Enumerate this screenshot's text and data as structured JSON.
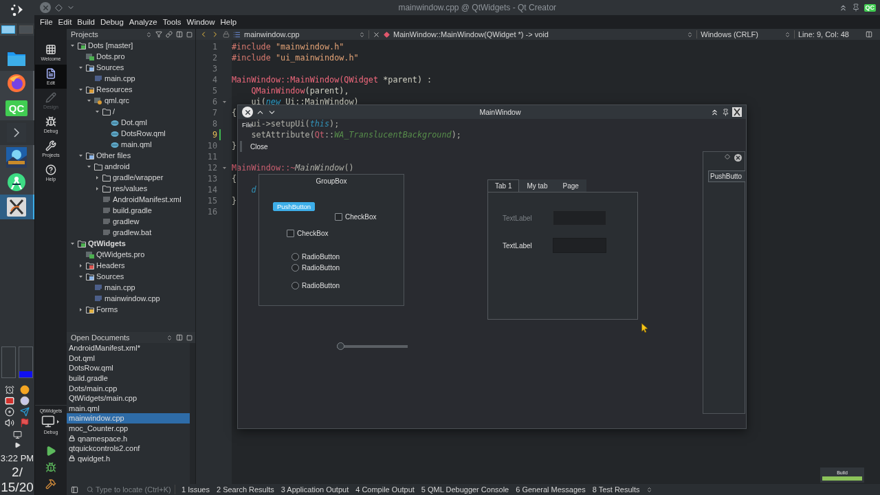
{
  "window": {
    "title": "mainwindow.cpp @ QtWidgets - Qt Creator",
    "badge": "QC"
  },
  "taskbar": {
    "desktops": [
      {
        "selected": true
      },
      {
        "selected": false
      }
    ],
    "apps": [
      {
        "kind": "folder",
        "running": false,
        "selected": false
      },
      {
        "kind": "browser",
        "running": true,
        "selected": false
      },
      {
        "kind": "ide",
        "text": "QC",
        "running": true,
        "selected": false
      },
      {
        "kind": "terminal",
        "running": false,
        "selected": false
      },
      {
        "kind": "game",
        "running": true,
        "selected": false
      },
      {
        "kind": "android",
        "running": true,
        "selected": false
      },
      {
        "kind": "xapp",
        "running": true,
        "selected": true
      }
    ],
    "meters": [
      {
        "level": 0
      },
      {
        "level": 0.2
      }
    ],
    "clock": [
      "3:22 PM",
      "2/",
      "15/20"
    ]
  },
  "menu": [
    "File",
    "Edit",
    "Build",
    "Debug",
    "Analyze",
    "Tools",
    "Window",
    "Help"
  ],
  "modes": [
    {
      "label": "Welcome",
      "kind": "welcome",
      "selected": false,
      "disabled": false
    },
    {
      "label": "Edit",
      "kind": "edit",
      "selected": true,
      "disabled": false
    },
    {
      "label": "Design",
      "kind": "design",
      "selected": false,
      "disabled": true
    },
    {
      "label": "Debug",
      "kind": "debug",
      "selected": false,
      "disabled": false
    },
    {
      "label": "Projects",
      "kind": "projects",
      "selected": false,
      "disabled": false
    },
    {
      "label": "Help",
      "kind": "help",
      "selected": false,
      "disabled": false
    }
  ],
  "kit": {
    "project": "QtWidgets",
    "config": "Debug"
  },
  "projects": {
    "title": "Projects",
    "tree": [
      {
        "label": "Dots [master]",
        "kind": "project",
        "expanded": true,
        "active": false,
        "children": [
          {
            "label": "Dots.pro",
            "kind": "pro"
          },
          {
            "label": "Sources",
            "kind": "sources",
            "expanded": true,
            "children": [
              {
                "label": "main.cpp",
                "kind": "cpp"
              }
            ]
          },
          {
            "label": "Resources",
            "kind": "resources",
            "expanded": true,
            "children": [
              {
                "label": "qml.qrc",
                "kind": "qrc",
                "expanded": true,
                "children": [
                  {
                    "label": "/",
                    "kind": "folder",
                    "expanded": true,
                    "children": [
                      {
                        "label": "Dot.qml",
                        "kind": "qml"
                      },
                      {
                        "label": "DotsRow.qml",
                        "kind": "qml"
                      },
                      {
                        "label": "main.qml",
                        "kind": "qml"
                      }
                    ]
                  }
                ]
              }
            ]
          },
          {
            "label": "Other files",
            "kind": "sources",
            "expanded": true,
            "children": [
              {
                "label": "android",
                "kind": "folder",
                "expanded": true,
                "children": [
                  {
                    "label": "gradle/wrapper",
                    "kind": "folder",
                    "expanded": false
                  },
                  {
                    "label": "res/values",
                    "kind": "folder",
                    "expanded": false
                  },
                  {
                    "label": "AndroidManifest.xml",
                    "kind": "file"
                  },
                  {
                    "label": "build.gradle",
                    "kind": "file"
                  },
                  {
                    "label": "gradlew",
                    "kind": "file"
                  },
                  {
                    "label": "gradlew.bat",
                    "kind": "file"
                  }
                ]
              }
            ]
          }
        ]
      },
      {
        "label": "QtWidgets",
        "kind": "project",
        "expanded": true,
        "active": true,
        "children": [
          {
            "label": "QtWidgets.pro",
            "kind": "pro"
          },
          {
            "label": "Headers",
            "kind": "headers",
            "expanded": false
          },
          {
            "label": "Sources",
            "kind": "sources",
            "expanded": true,
            "children": [
              {
                "label": "main.cpp",
                "kind": "cpp"
              },
              {
                "label": "mainwindow.cpp",
                "kind": "cpp"
              }
            ]
          },
          {
            "label": "Forms",
            "kind": "forms",
            "expanded": false
          }
        ]
      }
    ]
  },
  "open_documents": {
    "title": "Open Documents",
    "items": [
      {
        "name": "AndroidManifest.xml*",
        "locked": false,
        "selected": false
      },
      {
        "name": "Dot.qml",
        "locked": false,
        "selected": false
      },
      {
        "name": "DotsRow.qml",
        "locked": false,
        "selected": false
      },
      {
        "name": "build.gradle",
        "locked": false,
        "selected": false
      },
      {
        "name": "Dots/main.cpp",
        "locked": false,
        "selected": false
      },
      {
        "name": "QtWidgets/main.cpp",
        "locked": false,
        "selected": false
      },
      {
        "name": "main.qml",
        "locked": false,
        "selected": false
      },
      {
        "name": "mainwindow.cpp",
        "locked": false,
        "selected": true
      },
      {
        "name": "moc_Counter.cpp",
        "locked": false,
        "selected": false
      },
      {
        "name": "qnamespace.h",
        "locked": true,
        "selected": false
      },
      {
        "name": "qtquickcontrols2.conf",
        "locked": false,
        "selected": false
      },
      {
        "name": "qwidget.h",
        "locked": true,
        "selected": false
      }
    ]
  },
  "editor": {
    "file": "mainwindow.cpp",
    "symbol": "MainWindow::MainWindow(QWidget *) -> void",
    "line_ending": "Windows (CRLF)",
    "position": "Line: 9, Col: 48",
    "lines": [
      {
        "number": "1",
        "current": false,
        "modified": false,
        "foldable": false,
        "code": [
          {
            "kind": "pre",
            "text": "#include "
          },
          {
            "kind": "str",
            "text": "\"mainwindow.h\""
          }
        ]
      },
      {
        "number": "2",
        "current": false,
        "modified": false,
        "foldable": false,
        "code": [
          {
            "kind": "pre",
            "text": "#include "
          },
          {
            "kind": "str",
            "text": "\"ui_mainwindow.h\""
          }
        ]
      },
      {
        "number": "3",
        "current": false,
        "modified": false,
        "foldable": false
      },
      {
        "number": "4",
        "current": false,
        "modified": false,
        "foldable": false,
        "code": [
          {
            "kind": "type",
            "text": "MainWindow::MainWindow(QWidget"
          },
          {
            "kind": "plain",
            "text": " *parent) :"
          }
        ]
      },
      {
        "number": "5",
        "current": false,
        "modified": false,
        "foldable": false,
        "code": [
          {
            "kind": "type",
            "text": "    QMainWindow"
          },
          {
            "kind": "plain",
            "text": "(parent),"
          }
        ]
      },
      {
        "number": "6",
        "current": false,
        "modified": false,
        "foldable": true,
        "code": [
          {
            "kind": "plain",
            "text": "    ui("
          },
          {
            "kind": "kw",
            "text": "new"
          },
          {
            "kind": "plain",
            "text": " Ui::MainWindow)"
          }
        ]
      },
      {
        "number": "7",
        "current": false,
        "modified": false,
        "foldable": false,
        "code": [
          {
            "kind": "plain",
            "text": "{"
          }
        ]
      },
      {
        "number": "8",
        "current": false,
        "modified": false,
        "foldable": false,
        "code": [
          {
            "kind": "plain",
            "text": "    ui->setupUi("
          },
          {
            "kind": "kw",
            "text": "this"
          },
          {
            "kind": "plain",
            "text": ");"
          }
        ]
      },
      {
        "number": "9",
        "current": true,
        "modified": true,
        "foldable": false,
        "code": [
          {
            "kind": "plain",
            "text": "    setAttribute("
          },
          {
            "kind": "type",
            "text": "Qt"
          },
          {
            "kind": "plain",
            "text": "::"
          },
          {
            "kind": "enumv",
            "text": "WA_TranslucentBackground"
          },
          {
            "kind": "plain",
            "text": ");"
          }
        ]
      },
      {
        "number": "10",
        "current": false,
        "modified": false,
        "foldable": false,
        "code": [
          {
            "kind": "plain",
            "text": "}"
          }
        ]
      },
      {
        "number": "11",
        "current": false,
        "modified": false,
        "foldable": false
      },
      {
        "number": "12",
        "current": false,
        "modified": false,
        "foldable": true,
        "code": [
          {
            "kind": "type",
            "text": "MainWindow::~"
          },
          {
            "kind": "ital",
            "text": "MainWindow"
          },
          {
            "kind": "plain",
            "text": "()"
          }
        ]
      },
      {
        "number": "13",
        "current": false,
        "modified": false,
        "foldable": false,
        "code": [
          {
            "kind": "plain",
            "text": "{"
          }
        ]
      },
      {
        "number": "14",
        "current": false,
        "modified": false,
        "foldable": false,
        "code": [
          {
            "kind": "kw",
            "text": "    d"
          }
        ]
      },
      {
        "number": "15",
        "current": false,
        "modified": false,
        "foldable": false,
        "code": [
          {
            "kind": "plain",
            "text": "}"
          }
        ]
      },
      {
        "number": "16",
        "current": false,
        "modified": false,
        "foldable": false
      }
    ]
  },
  "preview": {
    "title": "MainWindow",
    "menu": "File",
    "menu_items": [
      "Close"
    ],
    "groupbox": {
      "title": "GroupBox",
      "button": {
        "label": "PushButton",
        "highlighted": true
      },
      "checkboxes": [
        {
          "label": "CheckBox",
          "checked": false
        },
        {
          "label": "CheckBox",
          "checked": false
        }
      ],
      "radios": [
        {
          "label": "RadioButton",
          "selected": false
        },
        {
          "label": "RadioButton",
          "selected": false
        },
        {
          "label": "RadioButton",
          "selected": false
        }
      ]
    },
    "slider": {
      "level": 0
    },
    "tabs": [
      {
        "label": "Tab 1",
        "selected": true
      },
      {
        "label": "My tab",
        "selected": false
      },
      {
        "label": "Page",
        "selected": false
      }
    ],
    "fields": [
      {
        "label": "TextLabel",
        "disabled": true
      },
      {
        "label": "TextLabel",
        "disabled": false
      }
    ],
    "dock": {
      "button": "PushButto"
    }
  },
  "status_bar": {
    "placeholder": "Type to locate (Ctrl+K)",
    "panes": [
      "1 Issues",
      "2 Search Results",
      "3 Application Output",
      "4 Compile Output",
      "5 QML Debugger Console",
      "6 General Messages",
      "8 Test Results"
    ],
    "build": {
      "label": "Build",
      "level": 1
    }
  }
}
